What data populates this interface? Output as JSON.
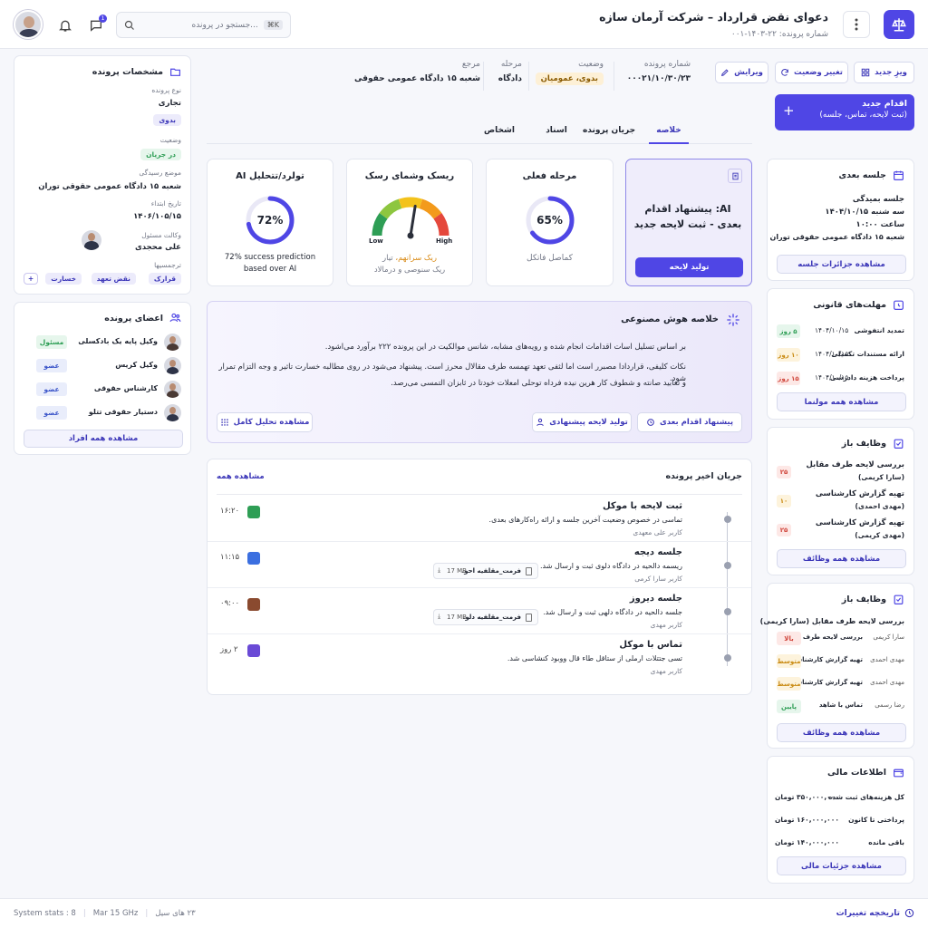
{
  "header": {
    "title": "دعوای نقض قرارداد – شرکت آرمان سازه",
    "case_number": "شماره پرونده: ۲۲-۱۴۰۳-۰۰۱",
    "search_placeholder": "جستجو در پرونده...",
    "search_shortcut": "⌘K",
    "notif_badge": "1"
  },
  "toolbar": {
    "new_wizard": "ویزِ جدید",
    "change_status": "تغییر وضعیت",
    "edit": "ویرایش"
  },
  "summary": [
    {
      "label": "شماره پرونده",
      "value": "۰۰۰۲۱/۱۰/۳۰/۲۳"
    },
    {
      "label": "وضعیت",
      "value": "بدوی، عمومیان"
    },
    {
      "label": "مرحله",
      "value": "دادگاه"
    },
    {
      "label": "مرجع",
      "value": "شعبه ۱۵ دادگاه عمومی حقوقی"
    }
  ],
  "new_action": {
    "title": "اقدام جدید",
    "sub": "(ثبت لایحه، تماس، جلسه)"
  },
  "tabs": [
    "خلاصه",
    "جریان پرونده",
    "اسناد",
    "اشخاص"
  ],
  "ai_card": {
    "title": "AI: پیشنهاد اقدام بعدی - ثبت لایحه جدید",
    "button": "تولید لایحه"
  },
  "stage_card": {
    "title": "مرحله فعلی",
    "percent": 65,
    "percent_label": "65%",
    "caption": "کماصل فاتکل"
  },
  "risk_card": {
    "title": "ریسک وشمای رسک",
    "low": "Low",
    "high": "High",
    "line1a": "ریک سرانهم،",
    "line1b": "تیار",
    "line2": "ریک سنوصی و درمالاد",
    "needle": 0.55
  },
  "predict_card": {
    "title": "تولرد/تتحلیل AI",
    "percent": 72,
    "percent_label": "72%",
    "line1": "72% success prediction",
    "line2": "based over AI"
  },
  "ai_summary": {
    "title": "خلاصه هوش مصنوعی",
    "p1": "بر اساس تسلیل اسات اقدامات انجام شده و رویه‌های مشابه، شانس موالکیت در این پرونده ۲۲۲ برآورد می‌اشود.",
    "p2": "نکات کلیفی، قراردادا مصبرر است اما لثفی تعهد تهمسه طرف مقالال محرز است. پیشنهاد می‌شود در روی مطالبه خسارت تاثیر و وجه التزام تمرار شود.",
    "p3": "و تعابید صانته و شطوف کار هرین نیده فرداه توحلی امعلات خودتا در ثابزان التمسی می‌رصد.",
    "btn_next": "پیشنهاد اقدام بعدی",
    "btn_brief": "تولید لایحه پیشنهادی",
    "btn_full": "مشاهده تحلیل کامل"
  },
  "timeline": {
    "title": "جریان اخیر پرونده",
    "view_all": "مشاهده همه",
    "items": [
      {
        "title": "ثبت لایحه با موکل",
        "desc": "تماسی در خصوص وضعیت آخرین جلسه و ارائه راه‌کارهای بعدی.",
        "user": "کاربر علی معهدی",
        "time": "۱۶:۲۰",
        "color": "#2e9e55",
        "file": "",
        "size": ""
      },
      {
        "title": "جلسه دیجه",
        "desc": "ریسمه دالحیه در دادگاه دلوی ثبت و ارسال شد.",
        "user": "کاربر سارا کرمی",
        "time": "۱۱:۱۵",
        "color": "#3b6fe0",
        "file": "فرمت_مقلفیه احو.",
        "size": "17 MB"
      },
      {
        "title": "جلسه دیروز",
        "desc": "جلسه دالحیه در دادگاه دلهی ثبت و ارسال شد.",
        "user": "کاربر مهدی",
        "time": "۰۹:۰۰",
        "color": "#8a4a2f",
        "file": "فرمت_مقلفیه دلو.",
        "size": "17 MB"
      },
      {
        "title": "تماس با موکل",
        "desc": "تسی جتتلات ارملی از ستاقل طاء قال ووبود کنشاسی شد.",
        "user": "کاربر مهدی",
        "time": "۲ روز",
        "color": "#6a4ad6",
        "file": "",
        "size": ""
      }
    ]
  },
  "case_details": {
    "title": "مشخصات پرونده",
    "type_label": "نوع پرونده",
    "type_value": "تجاری",
    "type_chip": "بدوی",
    "status_label": "وضعیت",
    "status_chip": "در جریان",
    "subject_label": "موضع رسیدگی",
    "subject_value": "شعبه ۱۵ دادگاه عمومی حقوقی توران",
    "start_label": "تاریخ ابتداء",
    "start_value": "۱۴۰۶/۱۰۵/۱۵",
    "lawyer_label": "وکالت مسئول",
    "lawyer_value": "علی محجدی",
    "tags_label": "ترجمسیها",
    "tags": [
      "قرارک",
      "نقض تعهد",
      "خسارت"
    ],
    "add_tag": "+"
  },
  "members": {
    "title": "اعضای پرونده",
    "items": [
      {
        "name": "وکیل پایه یک بادکسلی",
        "role": "مسئول",
        "role_color": "#2e9e55",
        "role_bg": "#e6f6ec"
      },
      {
        "name": "وکیل کریس",
        "role": "عضو",
        "role_color": "#3b55c9",
        "role_bg": "#e9edfb"
      },
      {
        "name": "کارشناس حقوقی",
        "role": "عضو",
        "role_color": "#3b55c9",
        "role_bg": "#e9edfb"
      },
      {
        "name": "دستیار حقوقی تتلو",
        "role": "عضو",
        "role_color": "#3b55c9",
        "role_bg": "#e9edfb"
      }
    ],
    "button": "مشاهده همه افراد"
  },
  "next_session": {
    "title": "جلسه بعدی",
    "l1": "جلسه بمیدگی",
    "l2": "سه شنبه ۱۴۰۴/۱۰/۱۵",
    "l3": "ساعت ۱۰:۰۰",
    "l4": "شعبه ۱۵ دادگاه عمومی حقوقی توران",
    "button": "مشاهده جزائرات جلسه"
  },
  "deadlines": {
    "title": "مهلت‌های قانونی",
    "items": [
      {
        "name": "تمدید انتفوشی",
        "date": "۱۴۰۴/۱۰/۱۵",
        "badge": "۵ روز",
        "color": "#2e9e55",
        "bg": "#e6f6ec"
      },
      {
        "name": "ارائه مستندات تکمیلی",
        "date": "۱۴۰۴/۱۰/۱۵",
        "badge": "۱۰ روز",
        "color": "#c98a12",
        "bg": "#fdf3dc"
      },
      {
        "name": "پرداخت هزینه دادرسی",
        "date": "۱۴۰۴/۱۰/۱۵",
        "badge": "۱۵ روز",
        "color": "#d0463c",
        "bg": "#fde8e6"
      }
    ],
    "button": "مشاهده همه مولنما"
  },
  "open_tasks": {
    "title": "وظایف باز",
    "items": [
      {
        "t1": "بررسی لایحه طرف مقابل",
        "t2": "(سارا کریمی)",
        "badge": "۲۵",
        "color": "#d0463c",
        "bg": "#fde8e6"
      },
      {
        "t1": "تهیه گزارش کارشناسی",
        "t2": "(مهدی احمدی)",
        "badge": "۱۰",
        "color": "#c98a12",
        "bg": "#fdf3dc"
      },
      {
        "t1": "تهیه گزارش کارشناسی",
        "t2": "(مهدی کریمی)",
        "badge": "۲۵",
        "color": "#d0463c",
        "bg": "#fde8e6"
      }
    ],
    "button": "مشاهده همه وظائف"
  },
  "open_tasks2": {
    "title": "وظایف باز",
    "header": "بررسی لایحه طرف مقابل (سارا کریمی)",
    "items": [
      {
        "person": "سارا کریمی",
        "task": "بررسی لایحه طرف مقابل",
        "badge": "بالا",
        "color": "#d0463c",
        "bg": "#fde8e6"
      },
      {
        "person": "مهدی احمدی",
        "task": "تهیه گزارش کارشناسی",
        "badge": "متوسط",
        "color": "#c98a12",
        "bg": "#fdf3dc"
      },
      {
        "person": "مهدی احمدی",
        "task": "تهیه گزارش کارشناسی",
        "badge": "متوسط",
        "color": "#c98a12",
        "bg": "#fdf3dc"
      },
      {
        "person": "رضا رسمی",
        "task": "تماس با شاهد",
        "badge": "پایین",
        "color": "#2e9e55",
        "bg": "#e6f6ec"
      }
    ],
    "button": "مشاهده همه وظائف"
  },
  "finance": {
    "title": "اطلاعات مالی",
    "items": [
      {
        "label": "کل هزینه‌های ثبت شده",
        "value": "۳۵۰,۰۰۰,۰۰۰ تومان"
      },
      {
        "label": "پرداختی تا کانون",
        "value": "۱۶۰,۰۰۰,۰۰۰ تومان"
      },
      {
        "label": "باقی مانده",
        "value": "۱۴۰,۰۰۰,۰۰۰ تومان"
      }
    ],
    "button": "مشاهده جزئیات مالی"
  },
  "footer": {
    "history": "تاریخچه تغییرات",
    "s1": "System stats : 8",
    "s2": "Mar 15 GHz",
    "s3": "۲۳ های سیل"
  },
  "colors": {
    "accent": "#4f46e5",
    "accent_dark": "#3b36b8",
    "ai_bg": "#efedfb"
  }
}
